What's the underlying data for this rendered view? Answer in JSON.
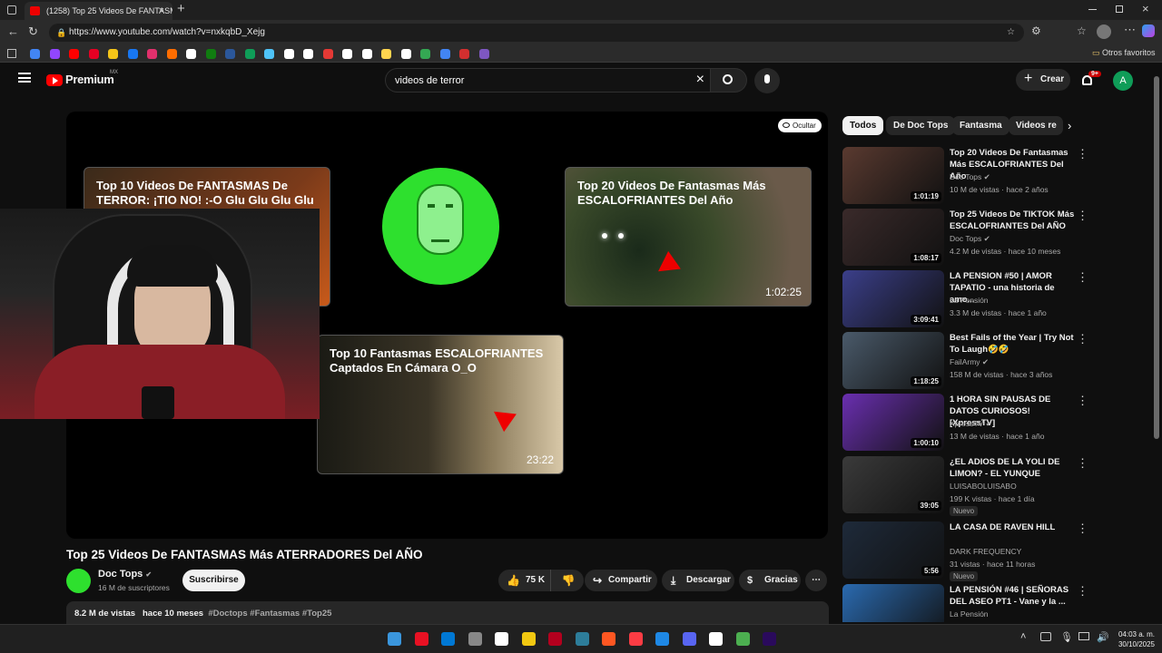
{
  "browser": {
    "tab_title": "(1258) Top 25 Videos De FANTASM",
    "new_tab": "+",
    "url": "https://www.youtube.com/watch?v=nxkqbD_Xejg",
    "favorites_label": "Otros favoritos",
    "bookmark_colors": [
      "#4285f4",
      "#9146ff",
      "#ff0000",
      "#e60023",
      "#f5c518",
      "#1877f2",
      "#e1306c",
      "#ff6d00",
      "#ffffff",
      "#107c10",
      "#2b579a",
      "#0f9d58",
      "#4fc3f7",
      "#ffffff",
      "#ffffff",
      "#e53935",
      "#ffffff",
      "#ffffff",
      "#ffd54f",
      "#ffffff",
      "#34a853",
      "#4285f4",
      "#d32f2f",
      "#7e57c2"
    ]
  },
  "youtube": {
    "logo_text": "Premium",
    "logo_region": "MX",
    "search_value": "videos de terror",
    "create_label": "Crear",
    "notif_badge": "9+",
    "avatar_letter": "A"
  },
  "player": {
    "hide_label": "Ocultar",
    "end_cards": [
      {
        "title": "Top 10 Videos De FANTASMAS De TERROR: ¡TIO NO! :-O Glu Glu Glu Glu",
        "duration": ""
      },
      {
        "title": "Top 20 Videos De Fantasmas Más ESCALOFRIANTES Del Año",
        "duration": "1:02:25"
      },
      {
        "title": "Top 10 Fantasmas ESCALOFRIANTES Captados En Cámara O_O",
        "duration": "23:22"
      }
    ]
  },
  "video": {
    "title": "Top 25 Videos De FANTASMAS Más ATERRADORES Del AÑO",
    "channel": "Doc Tops",
    "subscribers": "16 M de suscriptores",
    "subscribe_label": "Suscribirse",
    "likes": "75 K",
    "share_label": "Compartir",
    "download_label": "Descargar",
    "thanks_label": "Gracias",
    "views": "8.2 M de vistas",
    "age": "hace 10 meses",
    "hashtags": "#Doctops #Fantasmas #Top25"
  },
  "chips": [
    "Todos",
    "De Doc Tops",
    "Fantasma",
    "Videos re"
  ],
  "recommendations": [
    {
      "title": "Top 20 Videos De Fantasmas Más ESCALOFRIANTES Del Año",
      "channel": "Doc Tops",
      "meta": "10 M de vistas · hace 2 años",
      "duration": "1:01:19",
      "verified": true,
      "badge": ""
    },
    {
      "title": "Top 25 Videos De TIKTOK Más ESCALOFRIANTES Del AÑO",
      "channel": "Doc Tops",
      "meta": "4.2 M de vistas · hace 10 meses",
      "duration": "1:08:17",
      "verified": true,
      "badge": ""
    },
    {
      "title": "LA PENSION #50 | AMOR TAPATIO - una historia de amo...",
      "channel": "La Pensión",
      "meta": "3.3 M de vistas · hace 1 año",
      "duration": "3:09:41",
      "verified": false,
      "badge": ""
    },
    {
      "title": "Best Fails of the Year | Try Not To Laugh🤣🤣",
      "channel": "FailArmy",
      "meta": "158 M de vistas · hace 3 años",
      "duration": "1:18:25",
      "verified": true,
      "badge": ""
    },
    {
      "title": "1 HORA SIN PAUSAS DE DATOS CURIOSOS! [XpressTV]",
      "channel": "XpressTV",
      "meta": "13 M de vistas · hace 1 año",
      "duration": "1:00:10",
      "verified": true,
      "badge": ""
    },
    {
      "title": "¿EL ADIOS DE LA YOLI DE LIMON? - EL YUNQUE",
      "channel": "LUISABOLUISABO",
      "meta": "199 K vistas · hace 1 día",
      "duration": "39:05",
      "verified": false,
      "badge": "Nuevo"
    },
    {
      "title": "LA CASA DE RAVEN HILL",
      "channel": "DARK FREQUENCY",
      "meta": "31 vistas · hace 11 horas",
      "duration": "5:56",
      "verified": false,
      "badge": "Nuevo"
    },
    {
      "title": "LA PENSIÓN #46 | SEÑORAS DEL ASEO PT1 - Vane y la ...",
      "channel": "La Pensión",
      "meta": "",
      "duration": "",
      "verified": false,
      "badge": ""
    }
  ],
  "thumb_colors": [
    "#5a3a30",
    "#3a2a2a",
    "#3b3f8a",
    "#4a5a6a",
    "#6a2fb0",
    "#3a3a3a",
    "#1e2a3a",
    "#2a6ab0"
  ],
  "taskbar": {
    "time": "04:03 a. m.",
    "date": "30/10/2025",
    "icon_colors": [
      "#3a96dd",
      "#e81123",
      "#0078d4",
      "#888888",
      "#ffffff",
      "#f2c811",
      "#b4001e",
      "#2d7d9a",
      "#ff5722",
      "#fc3c44",
      "#1e88e5",
      "#5865f2",
      "#ffffff",
      "#4caf50",
      "#2a0a5c"
    ]
  }
}
